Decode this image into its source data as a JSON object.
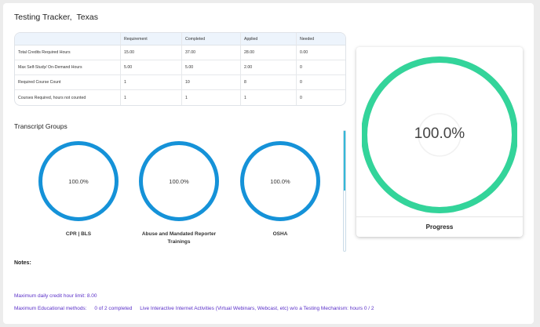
{
  "header": {
    "title": "Testing Tracker,",
    "state": "Texas"
  },
  "table": {
    "columns": [
      "",
      "Requirement",
      "Completed",
      "Applied",
      "Needed"
    ],
    "rows": [
      [
        "Total Credits Required Hours",
        "15.00",
        "37.00",
        "28.00",
        "0.00"
      ],
      [
        "Max Self-Study/ On-Demand Hours",
        "5.00",
        "5.00",
        "2.00",
        "0"
      ],
      [
        "Required Course Count",
        "1",
        "10",
        "8",
        "0"
      ],
      [
        "Courses Required, hours not counted",
        "1",
        "1",
        "1",
        "0"
      ]
    ]
  },
  "transcript": {
    "title": "Transcript Groups",
    "groups": [
      {
        "percent": "100.0%",
        "label_line1": "CPR | BLS",
        "label_line2": ""
      },
      {
        "percent": "100.0%",
        "label_line1": "Abuse and Mandated Reporter",
        "label_line2": "Trainings"
      },
      {
        "percent": "100.0%",
        "label_line1": "OSHA",
        "label_line2": ""
      }
    ],
    "ring_color": "#1592d8"
  },
  "notes": {
    "title": "Notes:",
    "daily_limit": "Maximum daily credit hour limit: 8.00",
    "edu_methods_label": "Maximum Educational methods:",
    "edu_methods_count": "0 of 2 completed",
    "live_interactive": "Live Interactive Internet Activities (Virtual Webinars, Webcast, etc) w/o a Testing Mechanism: hours 0 / 2"
  },
  "progress": {
    "percent": "100.0%",
    "value": 1.0,
    "label": "Progress",
    "ring_color": "#33d49a"
  }
}
